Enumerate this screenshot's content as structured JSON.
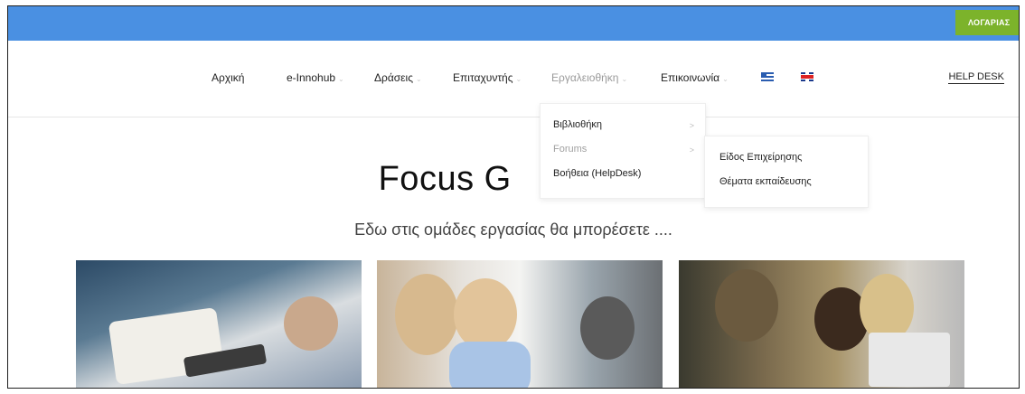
{
  "topbar": {
    "account_label": "ΛΟΓΑΡΙΑΣ"
  },
  "nav": {
    "items": [
      {
        "label": "Αρχική"
      },
      {
        "label": "e-Innohub"
      },
      {
        "label": "Δράσεις"
      },
      {
        "label": "Επιταχυντής"
      },
      {
        "label": "Εργαλειοθήκη"
      },
      {
        "label": "Επικοινωνία"
      }
    ],
    "helpdesk_label": "HELP DESK",
    "flags": [
      "greek-flag-icon",
      "uk-flag-icon"
    ]
  },
  "dropdown": {
    "items": [
      {
        "label": "Βιβλιοθήκη"
      },
      {
        "label": "Forums"
      },
      {
        "label": "Βοήθεια (HelpDesk)"
      }
    ],
    "submenu": [
      {
        "label": "Είδος Επιχείρησης"
      },
      {
        "label": "Θέματα εκπαίδευσης"
      }
    ]
  },
  "hero": {
    "title": "Focus G          ps",
    "subtitle": "Εδω στις ομάδες εργασίας θα μπορέσετε ...."
  },
  "colors": {
    "topbar": "#4a90e2",
    "account": "#7cb32b"
  }
}
